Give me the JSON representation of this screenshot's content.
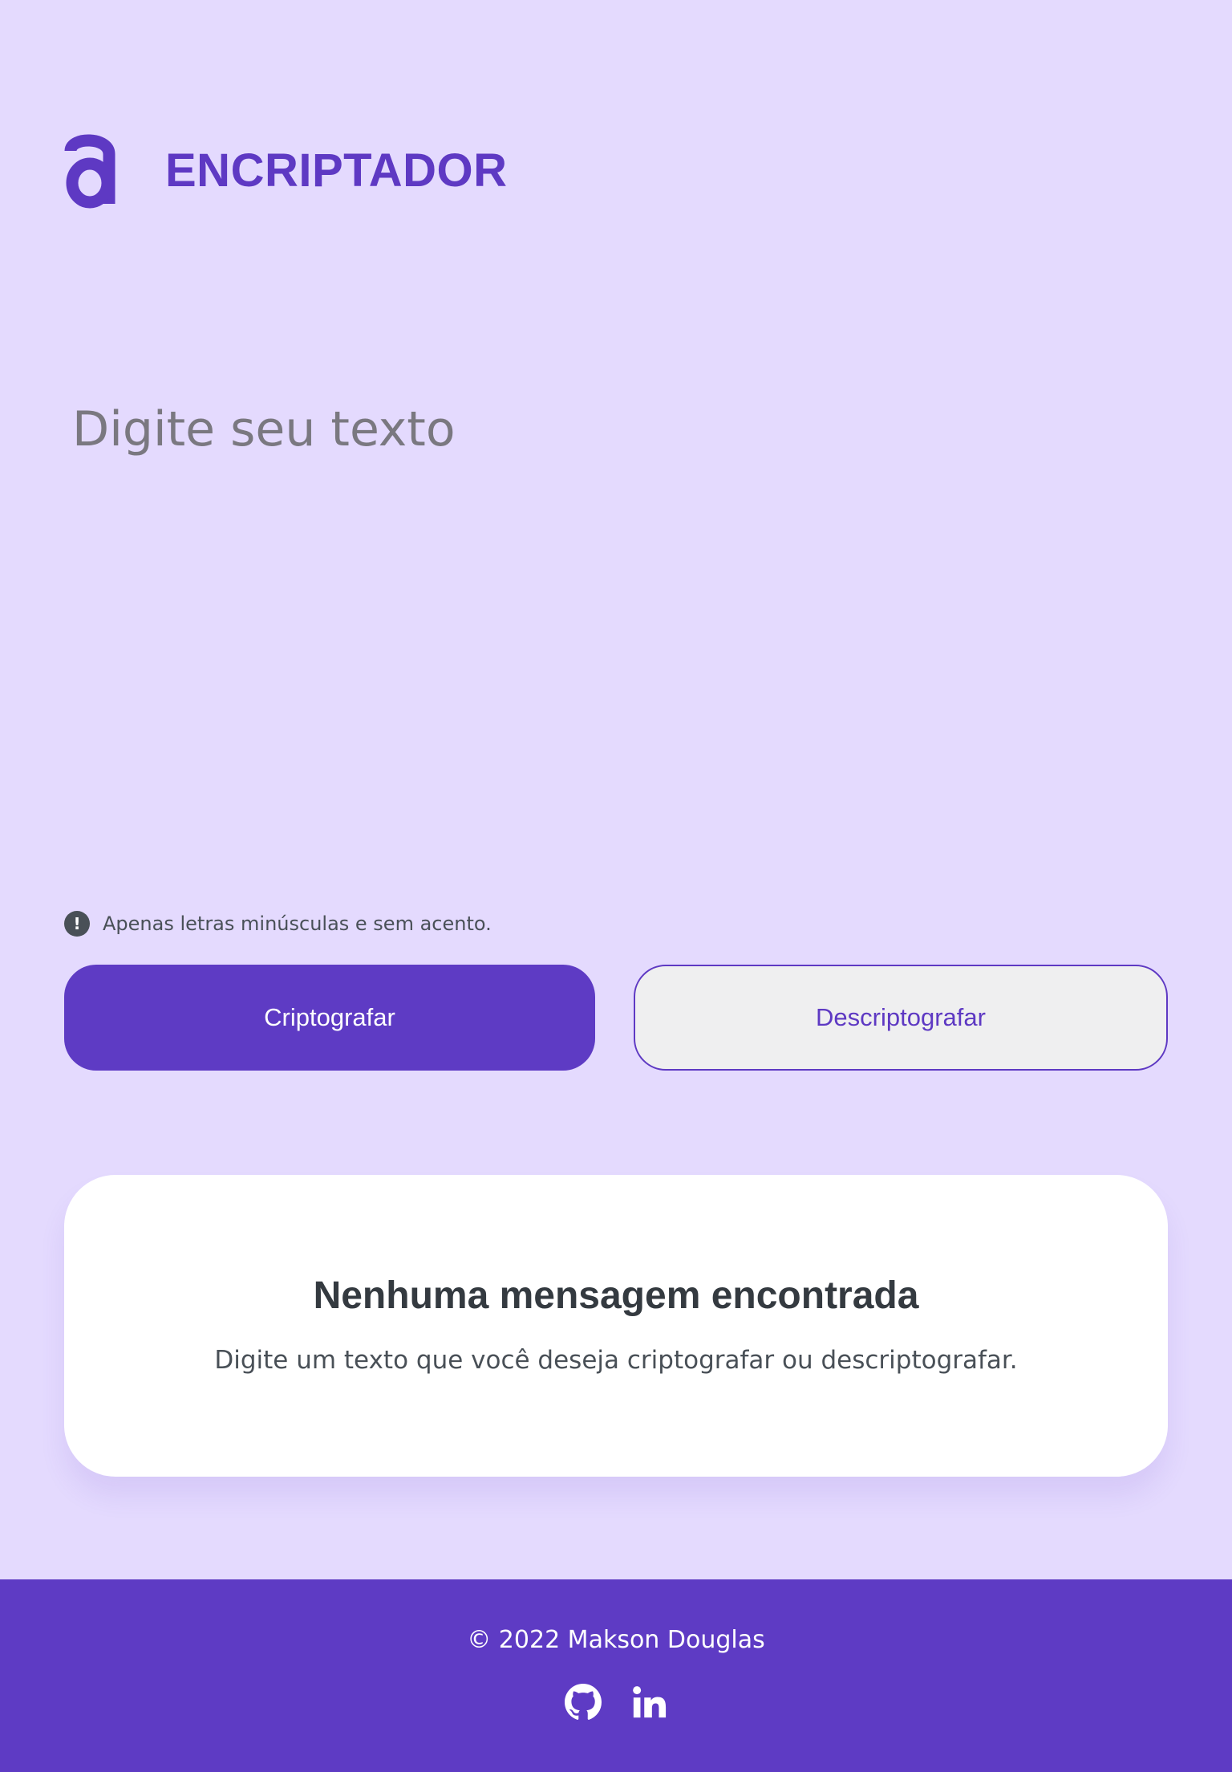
{
  "header": {
    "brand": "ENCRIPTADOR",
    "logo_icon": "alura-a-logo"
  },
  "editor": {
    "placeholder": "Digite seu texto"
  },
  "hint": {
    "icon": "exclamation-circle-icon",
    "text": "Apenas letras minúsculas e sem acento."
  },
  "actions": {
    "encrypt_label": "Criptografar",
    "decrypt_label": "Descriptografar"
  },
  "result": {
    "title": "Nenhuma mensagem encontrada",
    "message": "Digite um texto que você deseja criptografar ou descriptografar."
  },
  "footer": {
    "copyright": "© 2022 Makson Douglas",
    "social": [
      {
        "icon": "github-icon"
      },
      {
        "icon": "linkedin-icon"
      }
    ]
  },
  "colors": {
    "background": "#e4dafe",
    "accent": "#5e39c3",
    "button_secondary_bg": "#efeff0",
    "card": "#ffffff",
    "text_dark": "#343a40"
  }
}
